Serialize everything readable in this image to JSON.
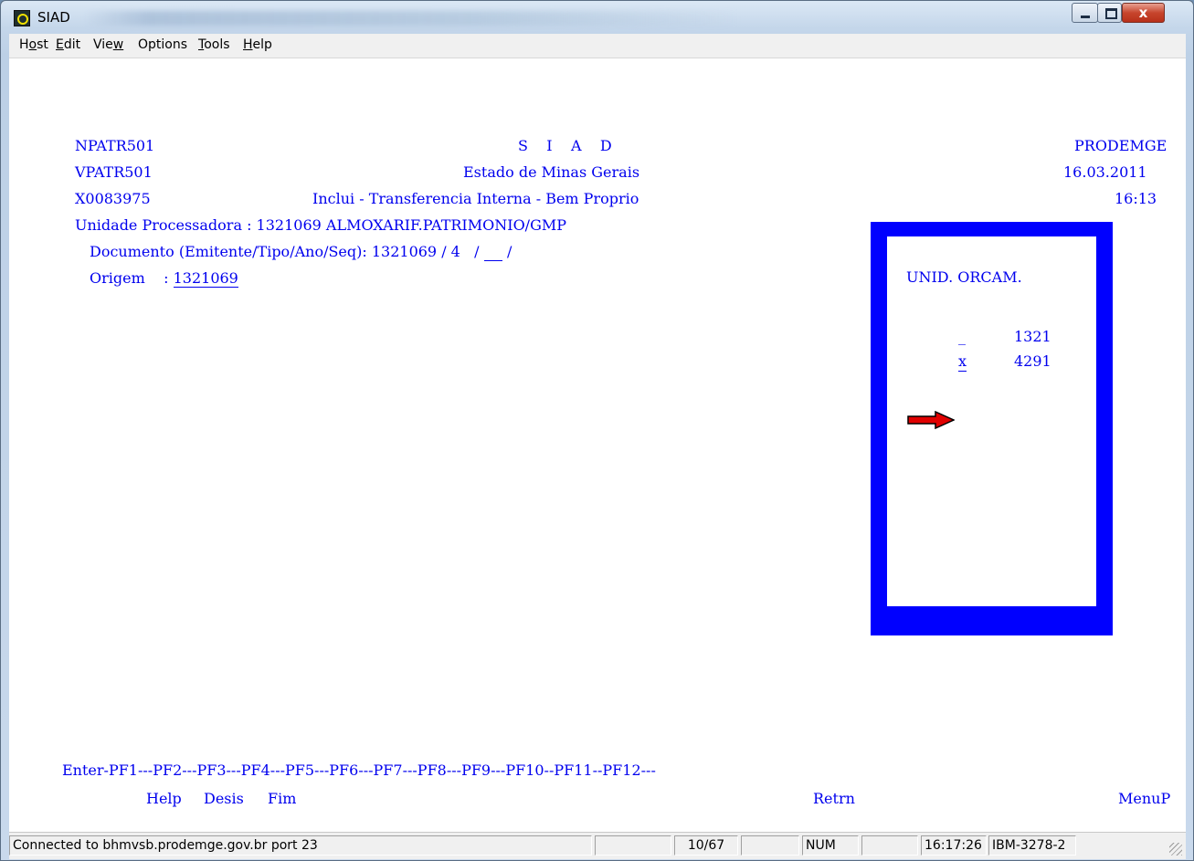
{
  "window": {
    "title": "SIAD"
  },
  "menu": {
    "host": {
      "pre": "H",
      "u": "o",
      "post": "st"
    },
    "edit": {
      "pre": "",
      "u": "E",
      "post": "dit"
    },
    "view": {
      "pre": "Vie",
      "u": "w",
      "post": ""
    },
    "options": {
      "pre": "Options",
      "u": "",
      "post": ""
    },
    "tools": {
      "pre": "",
      "u": "T",
      "post": "ools"
    },
    "help": {
      "pre": "",
      "u": "H",
      "post": "elp"
    }
  },
  "screen": {
    "program1": "NPATR501",
    "program2": "VPATR501",
    "program3": "X0083975",
    "system_title": "S    I    A    D",
    "state": "Estado de Minas Gerais",
    "operation": "Inclui - Transferencia Interna - Bem Proprio",
    "company": "PRODEMGE",
    "date": "16.03.2011",
    "time": "16:13",
    "unidade_label": "Unidade Processadora : 1321069 ALMOXARIF.PATRIMONIO/GMP",
    "documento_label": "Documento (Emitente/Tipo/Ano/Seq): 1321069 / 4   / ",
    "documento_ano": "    ",
    "documento_sep": " /",
    "origem_label": "Origem    : ",
    "origem_value": "1321069",
    "popup": {
      "header": "UNID. ORCAM.",
      "rows": [
        {
          "select": "_",
          "value": "1321"
        },
        {
          "select": "x",
          "value": "4291"
        }
      ]
    },
    "pf_keys": "Enter-PF1---PF2---PF3---PF4---PF5---PF6---PF7---PF8---PF9---PF10--PF11--PF12---",
    "pf_help": "Help",
    "pf_desis": "Desis",
    "pf_fim": "Fim",
    "pf_retrn": "Retrn",
    "pf_menup": "MenuP"
  },
  "status": {
    "connection": "Connected to bhmvsb.prodemge.gov.br port 23",
    "cursor": "10/67",
    "num": "NUM",
    "clock": "16:17:26",
    "terminal": "IBM-3278-2"
  },
  "colors": {
    "terminal_text": "#0000ee",
    "popup_border": "#0000ff",
    "arrow": "#e00000"
  }
}
